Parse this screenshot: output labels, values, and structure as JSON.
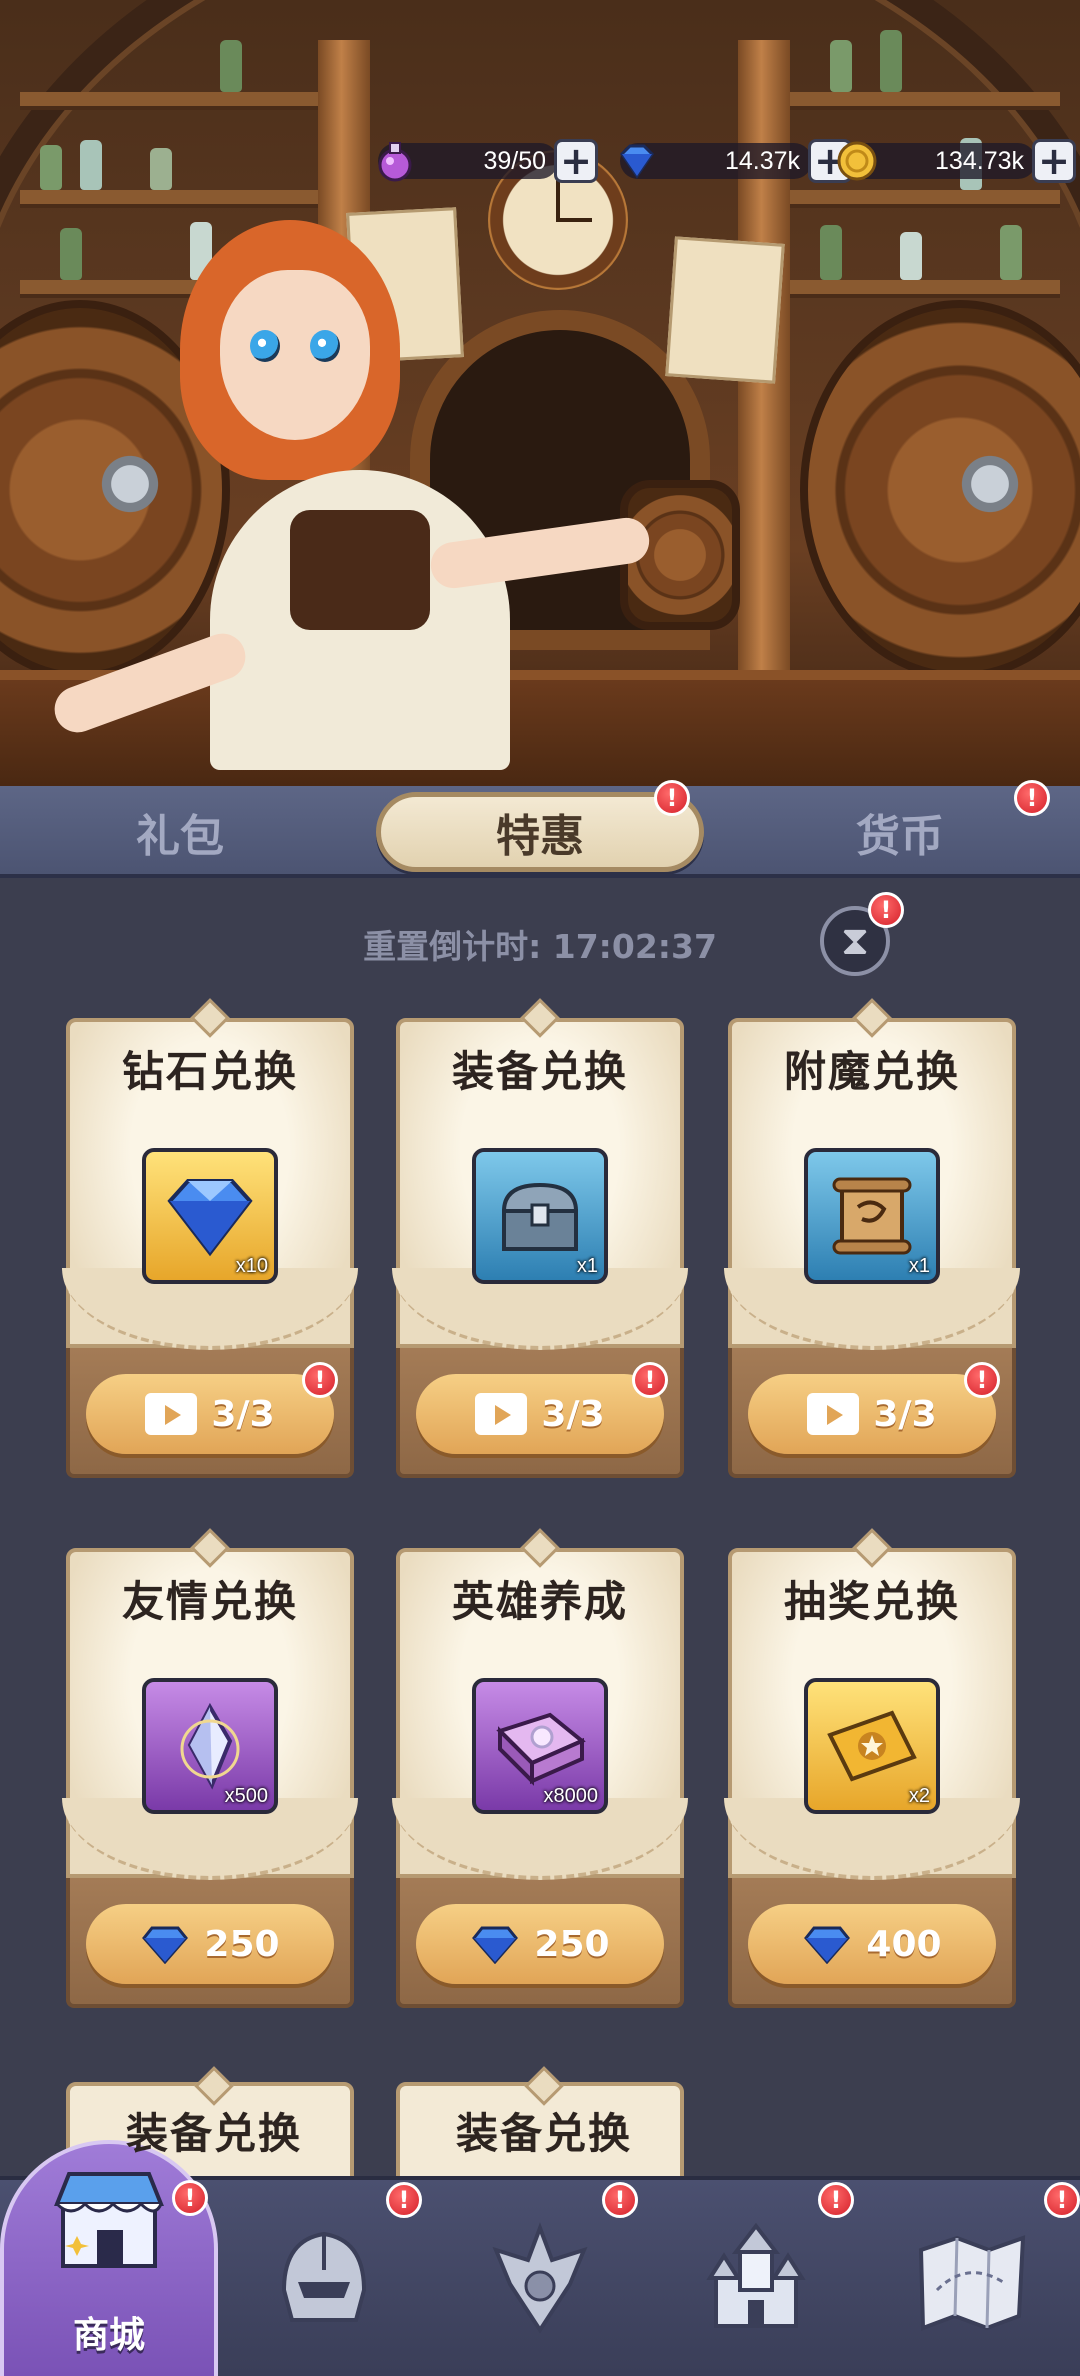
{
  "resources": [
    {
      "icon": "potion-icon",
      "value": "39/50"
    },
    {
      "icon": "diamond-icon",
      "value": "14.37k"
    },
    {
      "icon": "gold-coin-icon",
      "value": "134.73k"
    }
  ],
  "tabs": [
    {
      "label": "礼包",
      "active": false,
      "badge": false
    },
    {
      "label": "特惠",
      "active": true,
      "badge": true
    },
    {
      "label": "货币",
      "active": false,
      "badge": true
    }
  ],
  "badge_mark": "!",
  "countdown": "重置倒计时: 17:02:37",
  "cards": [
    {
      "title": "钻石兑换",
      "item_icon": "diamond-icon",
      "quantity": "x10",
      "button": "3/3",
      "button_type": "video",
      "badge": true
    },
    {
      "title": "装备兑换",
      "item_icon": "chest-icon",
      "quantity": "x1",
      "button": "3/3",
      "button_type": "video",
      "badge": true
    },
    {
      "title": "附魔兑换",
      "item_icon": "scroll-icon",
      "quantity": "x1",
      "button": "3/3",
      "button_type": "video",
      "badge": true
    },
    {
      "title": "友情兑换",
      "item_icon": "crystal-shard-icon",
      "quantity": "x500",
      "button": "250",
      "button_type": "diamond",
      "badge": false
    },
    {
      "title": "英雄养成",
      "item_icon": "spellbook-icon",
      "quantity": "x8000",
      "button": "250",
      "button_type": "diamond",
      "badge": false
    },
    {
      "title": "抽奖兑换",
      "item_icon": "ticket-icon",
      "quantity": "x2",
      "button": "400",
      "button_type": "diamond",
      "badge": false
    }
  ],
  "partial_cards": [
    {
      "title": "装备兑换"
    },
    {
      "title": "装备兑换"
    }
  ],
  "nav": [
    {
      "icon": "shop-icon",
      "label": "商城",
      "active": true
    },
    {
      "icon": "helmet-icon",
      "label": "",
      "active": false
    },
    {
      "icon": "crest-icon",
      "label": "",
      "active": false
    },
    {
      "icon": "castle-icon",
      "label": "",
      "active": false
    },
    {
      "icon": "map-icon",
      "label": "",
      "active": false
    }
  ],
  "colors": {
    "accent": "#e1a557",
    "badge": "#d4202a",
    "tab_bar": "#5d6686",
    "nav_active": "#8b63c6"
  }
}
